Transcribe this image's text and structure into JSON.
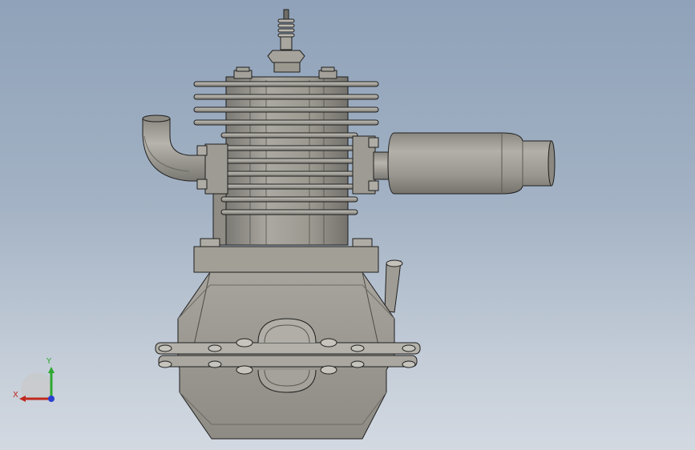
{
  "viewport": {
    "background_top": "#8fa2b9",
    "background_bottom": "#d3d9e1"
  },
  "model": {
    "part_color": "#9c9a92",
    "edge_color": "#1e1e1e"
  },
  "triad": {
    "x_label": "X",
    "y_label": "Y",
    "x_color": "#c0281e",
    "y_color": "#2da830",
    "z_color": "#2b3fcf"
  }
}
